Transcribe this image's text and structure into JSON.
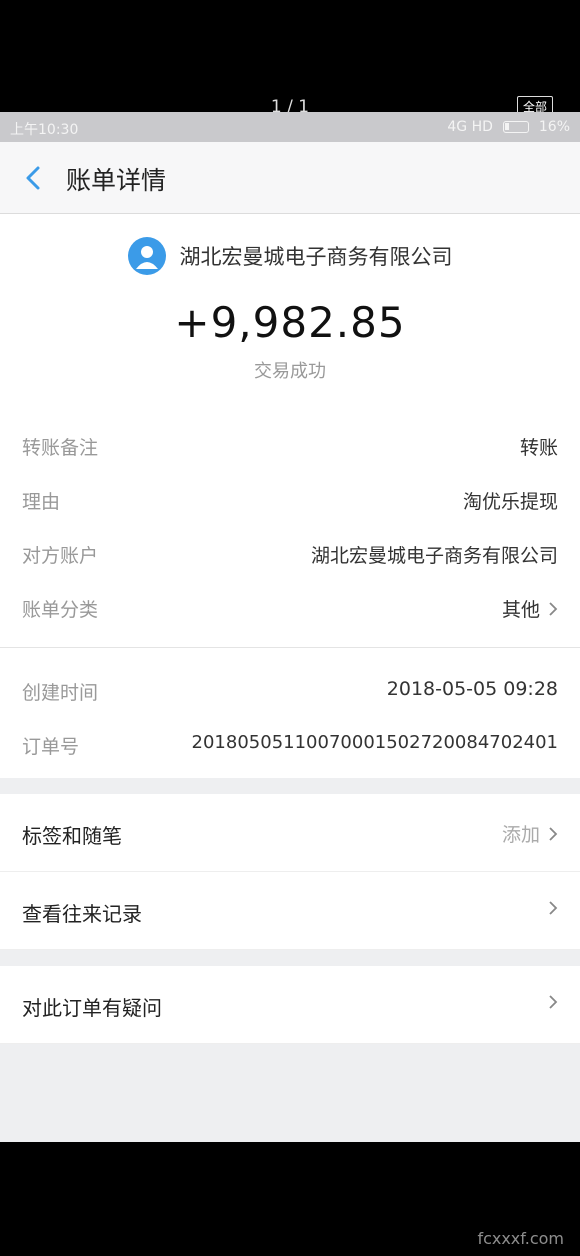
{
  "viewer": {
    "page_counter": "1 / 1",
    "all_label": "全部"
  },
  "status_bar": {
    "time": "上午10:30",
    "network": "4G HD",
    "battery": "16%"
  },
  "header": {
    "title": "账单详情"
  },
  "payee": {
    "name": "湖北宏曼城电子商务有限公司"
  },
  "amount": "+9,982.85",
  "status": "交易成功",
  "details": [
    {
      "label": "转账备注",
      "value": "转账"
    },
    {
      "label": "理由",
      "value": "淘优乐提现"
    },
    {
      "label": "对方账户",
      "value": "湖北宏曼城电子商务有限公司"
    },
    {
      "label": "账单分类",
      "value": "其他"
    }
  ],
  "meta": [
    {
      "label": "创建时间",
      "value": "2018-05-05 09:28"
    },
    {
      "label": "订单号",
      "value": "20180505110070001502720084702401"
    }
  ],
  "menu": [
    {
      "label": "标签和随笔",
      "value": "添加"
    },
    {
      "label": "查看往来记录",
      "value": ""
    },
    {
      "label": "对此订单有疑问",
      "value": ""
    }
  ],
  "watermark": "fcxxxf.com"
}
